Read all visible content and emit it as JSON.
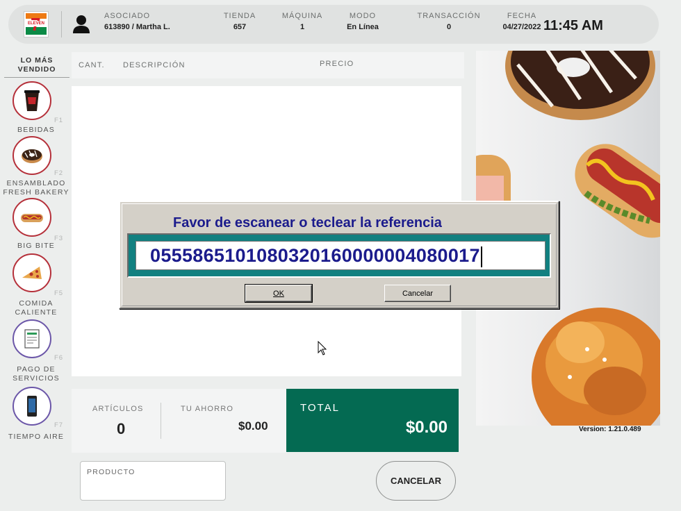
{
  "header": {
    "associate_label": "ASOCIADO",
    "associate_value": "613890 / Martha L.",
    "store_label": "TIENDA",
    "store_value": "657",
    "machine_label": "MÁQUINA",
    "machine_value": "1",
    "mode_label": "MODO",
    "mode_value": "En Línea",
    "transaction_label": "TRANSACCIÓN",
    "transaction_value": "0",
    "date_label": "FECHA",
    "date_value": "04/27/2022",
    "time": "11:45 AM"
  },
  "logo": {
    "seven": "7",
    "eleven": "ELEVEN"
  },
  "categories": {
    "title": "LO MÁS VENDIDO",
    "items": [
      {
        "name": "BEBIDAS",
        "key": "F1",
        "icon": "drink-cup-icon"
      },
      {
        "name": "ENSAMBLADO FRESH BAKERY",
        "key": "F2",
        "icon": "donut-icon"
      },
      {
        "name": "BIG BITE",
        "key": "F3",
        "icon": "hotdog-icon"
      },
      {
        "name": "COMIDA CALIENTE",
        "key": "F5",
        "icon": "pizza-icon"
      },
      {
        "name": "PAGO DE SERVICIOS",
        "key": "F6",
        "icon": "receipt-icon"
      },
      {
        "name": "TIEMPO AIRE",
        "key": "F7",
        "icon": "phone-icon"
      }
    ]
  },
  "ticket": {
    "col_qty": "CANT.",
    "col_desc": "DESCRIPCIÓN",
    "col_price": "PRECIO"
  },
  "summary": {
    "items_label": "ARTÍCULOS",
    "items_value": "0",
    "savings_label": "TU AHORRO",
    "savings_value": "$0.00",
    "total_label": "TOTAL",
    "total_value": "$0.00"
  },
  "bottom": {
    "product_label": "PRODUCTO",
    "cancel_label": "CANCELAR"
  },
  "version": "Version: 1.21.0.489",
  "dialog": {
    "prompt": "Favor de escanear o teclear la referencia",
    "input_value": "0555865101080320160000004080017",
    "ok_label": "OK",
    "cancel_label": "Cancelar"
  },
  "colors": {
    "total_bg": "#046a52",
    "category_border": "#b5303a",
    "dialog_teal": "#128080",
    "dialog_text": "#1b1b8c"
  }
}
